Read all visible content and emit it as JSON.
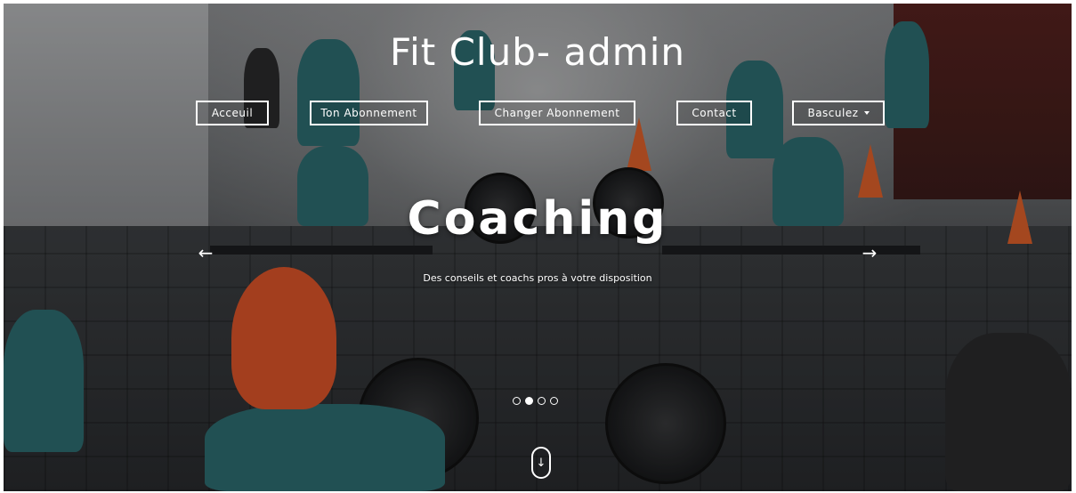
{
  "brand": {
    "title": "Fit Club- admin"
  },
  "nav": {
    "items": [
      {
        "label": "Acceuil"
      },
      {
        "label": "Ton Abonnement"
      },
      {
        "label": "Changer Abonnement"
      },
      {
        "label": "Contact"
      }
    ],
    "dropdown": {
      "label": "Basculez",
      "icon": "caret-down-icon"
    }
  },
  "carousel": {
    "title": "Coaching",
    "subtitle": "Des conseils et coachs pros à votre disposition",
    "prev_icon": "←",
    "next_icon": "→",
    "slide_count": 4,
    "active_index": 1
  },
  "scroll": {
    "icon": "↓"
  },
  "colors": {
    "overlay_text": "#ffffff",
    "accent_cap": "#e2572a",
    "shirt_teal": "#2f6f73"
  }
}
